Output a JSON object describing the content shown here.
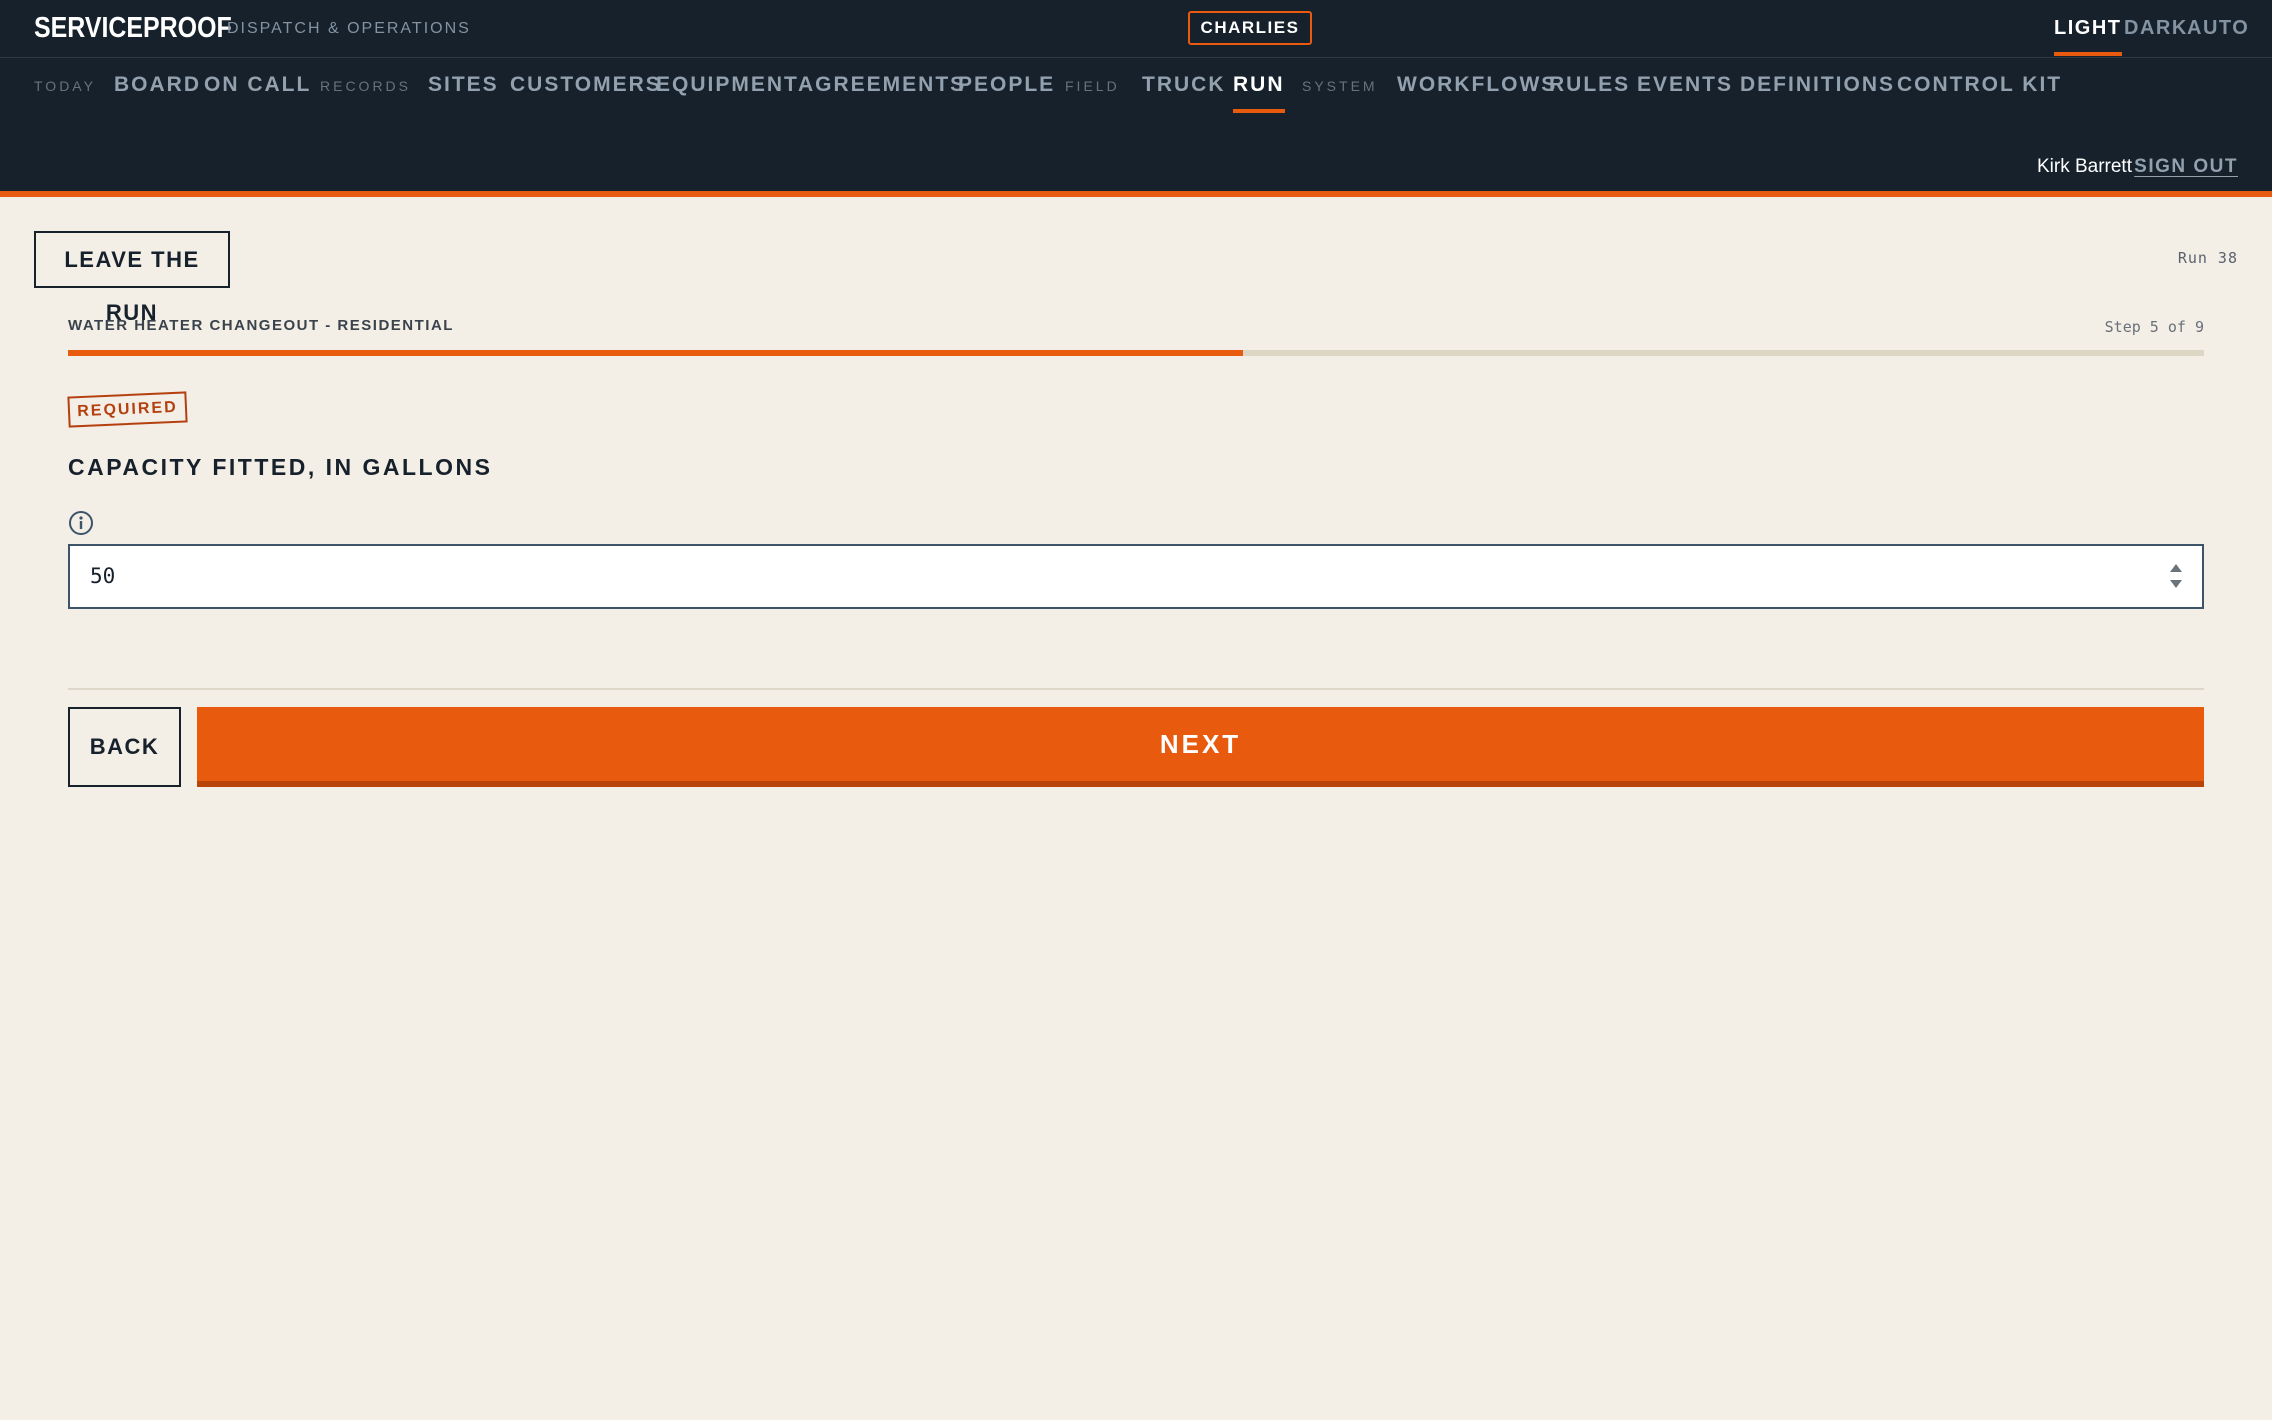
{
  "app": {
    "brand": "SERVICEPROOF",
    "subtitle": "DISPATCH & OPERATIONS",
    "tenant": "CHARLIES"
  },
  "theme": {
    "options": [
      "LIGHT",
      "DARK",
      "AUTO"
    ],
    "selected": "LIGHT"
  },
  "nav": {
    "sections": {
      "today": "TODAY",
      "records": "RECORDS",
      "field": "FIELD",
      "system": "SYSTEM"
    },
    "items": {
      "board": "BOARD",
      "on_call": "ON CALL",
      "sites": "SITES",
      "customers": "CUSTOMERS",
      "equipment": "EQUIPMENT",
      "agreements": "AGREEMENTS",
      "people": "PEOPLE",
      "truck": "TRUCK",
      "run": "RUN",
      "workflows": "WORKFLOWS",
      "rules": "RULES",
      "events": "EVENTS",
      "definitions": "DEFINITIONS",
      "control_kit": "CONTROL KIT"
    },
    "active": "RUN"
  },
  "user": {
    "name": "Kirk Barrett",
    "sign_out": "SIGN OUT"
  },
  "run": {
    "leave_label": "LEAVE THE RUN",
    "run_id": "Run 38",
    "workflow_name": "WATER HEATER CHANGEOUT - RESIDENTIAL",
    "step_label": "Step 5 of 9",
    "progress": 0.55
  },
  "question": {
    "badge": "REQUIRED",
    "text": "CAPACITY FITTED, IN GALLONS",
    "value": "50"
  },
  "actions": {
    "back": "BACK",
    "next": "NEXT"
  },
  "colors": {
    "accent": "#e85a0e",
    "header_bg": "#16212c",
    "page_bg": "#f3eee6",
    "required": "#b5400f"
  }
}
